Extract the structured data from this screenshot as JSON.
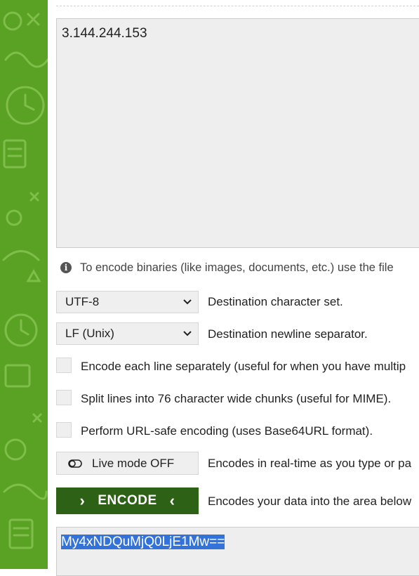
{
  "input": {
    "value": "3.144.244.153"
  },
  "info": {
    "text": "To encode binaries (like images, documents, etc.) use the file"
  },
  "charset": {
    "selected": "UTF-8",
    "label": "Destination character set."
  },
  "newline": {
    "selected": "LF (Unix)",
    "label": "Destination newline separator."
  },
  "options": {
    "encode_each_line": "Encode each line separately (useful for when you have multip",
    "split_lines": "Split lines into 76 character wide chunks (useful for MIME).",
    "url_safe": "Perform URL-safe encoding (uses Base64URL format)."
  },
  "live_mode": {
    "label": "Live mode OFF",
    "description": "Encodes in real-time as you type or pa"
  },
  "encode": {
    "label": "ENCODE",
    "description": "Encodes your data into the area below"
  },
  "output": {
    "value": "My4xNDQuMjQ0LjE1Mw=="
  },
  "colors": {
    "sidebar": "#5aa224",
    "encode_button": "#2d6216",
    "selection": "#3372d8"
  }
}
